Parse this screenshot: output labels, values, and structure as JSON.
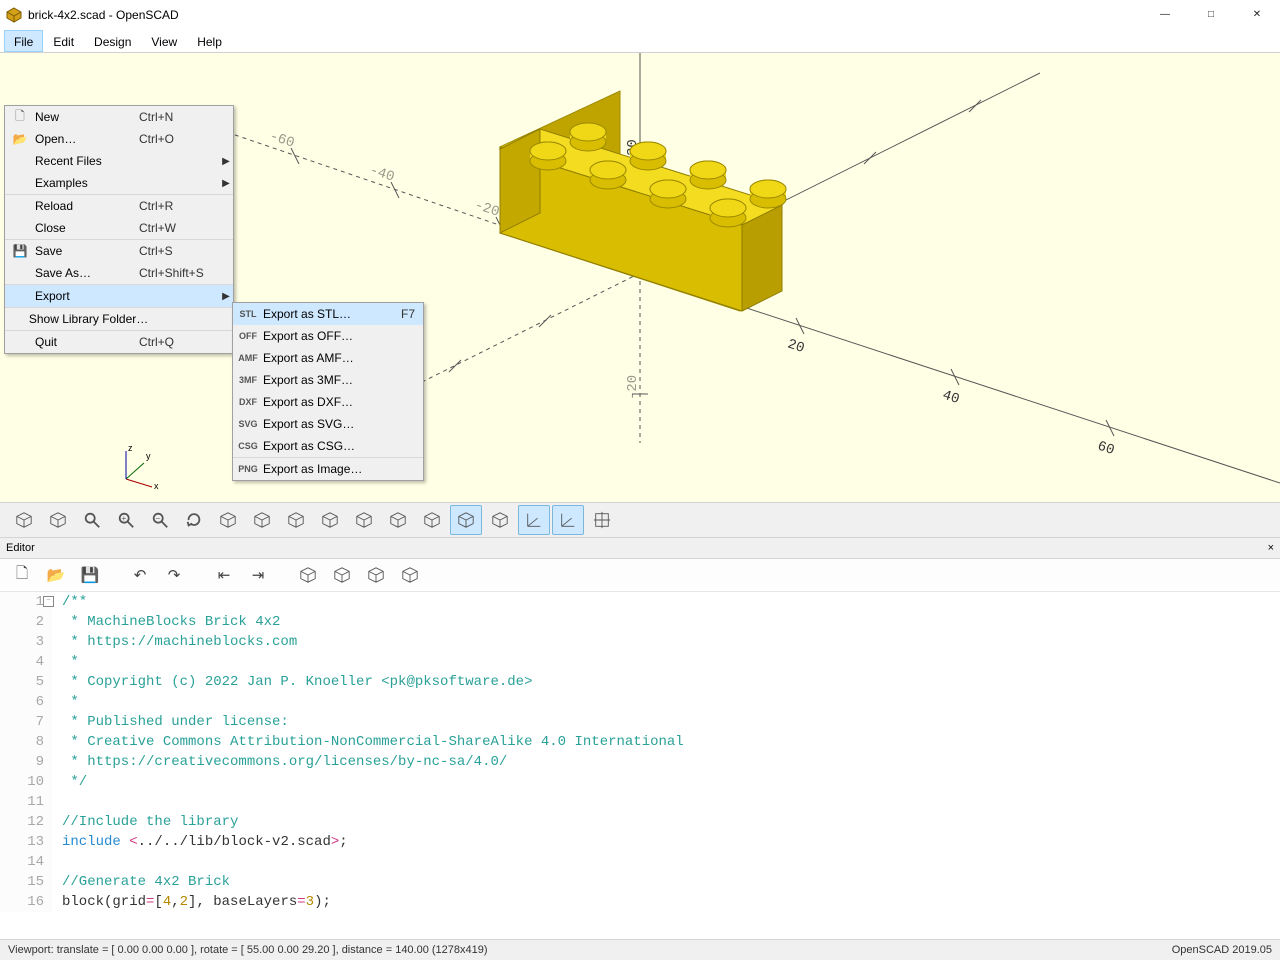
{
  "window": {
    "title": "brick-4x2.scad - OpenSCAD"
  },
  "menubar": [
    "File",
    "Edit",
    "Design",
    "View",
    "Help"
  ],
  "file_menu": [
    {
      "icon": "🗋",
      "label": "New",
      "shortcut": "Ctrl+N"
    },
    {
      "icon": "📂",
      "label": "Open…",
      "shortcut": "Ctrl+O"
    },
    {
      "icon": "",
      "label": "Recent Files",
      "submenu": true
    },
    {
      "icon": "",
      "label": "Examples",
      "submenu": true,
      "sep": true
    },
    {
      "icon": "",
      "label": "Reload",
      "shortcut": "Ctrl+R"
    },
    {
      "icon": "",
      "label": "Close",
      "shortcut": "Ctrl+W",
      "sep": true
    },
    {
      "icon": "💾",
      "label": "Save",
      "shortcut": "Ctrl+S"
    },
    {
      "icon": "",
      "label": "Save As…",
      "shortcut": "Ctrl+Shift+S",
      "sep": true
    },
    {
      "icon": "",
      "label": "Export",
      "submenu": true,
      "hover": true,
      "sep": true
    },
    {
      "icon": "",
      "label": "Show Library Folder…",
      "sep": true
    },
    {
      "icon": "",
      "label": "Quit",
      "shortcut": "Ctrl+Q"
    }
  ],
  "export_menu": [
    {
      "icon": "STL",
      "label": "Export as STL…",
      "shortcut": "F7",
      "hover": true
    },
    {
      "icon": "OFF",
      "label": "Export as OFF…"
    },
    {
      "icon": "AMF",
      "label": "Export as AMF…"
    },
    {
      "icon": "3MF",
      "label": "Export as 3MF…"
    },
    {
      "icon": "DXF",
      "label": "Export as DXF…"
    },
    {
      "icon": "SVG",
      "label": "Export as SVG…"
    },
    {
      "icon": "CSG",
      "label": "Export as CSG…",
      "sep": true
    },
    {
      "icon": "PNG",
      "label": "Export as Image…"
    }
  ],
  "axis_ticks": {
    "pos_x": [
      "20",
      "40",
      "60"
    ],
    "neg_x": [
      "-20",
      "-40",
      "-60"
    ],
    "pos_z": [
      "20"
    ],
    "neg_z": [
      "-20"
    ]
  },
  "axis_indicator": {
    "labels": [
      "x",
      "y",
      "z"
    ]
  },
  "editor": {
    "title": "Editor",
    "lines": [
      [
        {
          "cls": "c-comment",
          "t": "/**"
        }
      ],
      [
        {
          "cls": "c-comment",
          "t": " * MachineBlocks Brick 4x2"
        }
      ],
      [
        {
          "cls": "c-comment",
          "t": " * https://machineblocks.com"
        }
      ],
      [
        {
          "cls": "c-comment",
          "t": " *"
        }
      ],
      [
        {
          "cls": "c-comment",
          "t": " * Copyright (c) 2022 Jan P. Knoeller <pk@pksoftware.de>"
        }
      ],
      [
        {
          "cls": "c-comment",
          "t": " *"
        }
      ],
      [
        {
          "cls": "c-comment",
          "t": " * Published under license:"
        }
      ],
      [
        {
          "cls": "c-comment",
          "t": " * Creative Commons Attribution-NonCommercial-ShareAlike 4.0 International"
        }
      ],
      [
        {
          "cls": "c-comment",
          "t": " * https://creativecommons.org/licenses/by-nc-sa/4.0/"
        }
      ],
      [
        {
          "cls": "c-comment",
          "t": " */"
        }
      ],
      [
        {
          "cls": "c-plain",
          "t": ""
        }
      ],
      [
        {
          "cls": "c-comment",
          "t": "//Include the library"
        }
      ],
      [
        {
          "cls": "c-keyword",
          "t": "include"
        },
        {
          "cls": "c-plain",
          "t": " "
        },
        {
          "cls": "c-special",
          "t": "<"
        },
        {
          "cls": "c-plain",
          "t": "../../lib/block-v2.scad"
        },
        {
          "cls": "c-special",
          "t": ">"
        },
        {
          "cls": "c-plain",
          "t": ";"
        }
      ],
      [
        {
          "cls": "c-plain",
          "t": ""
        }
      ],
      [
        {
          "cls": "c-comment",
          "t": "//Generate 4x2 Brick"
        }
      ],
      [
        {
          "cls": "c-plain",
          "t": "block(grid"
        },
        {
          "cls": "c-special",
          "t": "="
        },
        {
          "cls": "c-plain",
          "t": "["
        },
        {
          "cls": "c-number",
          "t": "4"
        },
        {
          "cls": "c-plain",
          "t": ","
        },
        {
          "cls": "c-number",
          "t": "2"
        },
        {
          "cls": "c-plain",
          "t": "], baseLayers"
        },
        {
          "cls": "c-special",
          "t": "="
        },
        {
          "cls": "c-number",
          "t": "3"
        },
        {
          "cls": "c-plain",
          "t": ");"
        }
      ]
    ]
  },
  "toolbar_main_icons": [
    "preview-icon",
    "axes-icon",
    "zoom-fit-icon",
    "zoom-in-icon",
    "zoom-out-icon",
    "reset-view-icon",
    "view-all-icon",
    "front-icon",
    "back-icon",
    "left-icon",
    "right-icon",
    "top-icon",
    "bottom-icon",
    "perspective-icon",
    "ortho-icon",
    "show-axes-icon",
    "show-scale-icon",
    "crosshair-icon"
  ],
  "toolbar_main_active": [
    13,
    15,
    16
  ],
  "toolbar_editor_icons": [
    "new-file-icon",
    "open-file-icon",
    "save-file-icon",
    "undo-icon",
    "redo-icon",
    "unindent-icon",
    "indent-icon",
    "preview-icon",
    "render-icon",
    "export-stl-icon",
    "send-to-printer-icon"
  ],
  "statusbar": {
    "left": "Viewport: translate = [ 0.00 0.00 0.00 ], rotate = [ 55.00 0.00 29.20 ], distance = 140.00 (1278x419)",
    "right": "OpenSCAD 2019.05"
  }
}
